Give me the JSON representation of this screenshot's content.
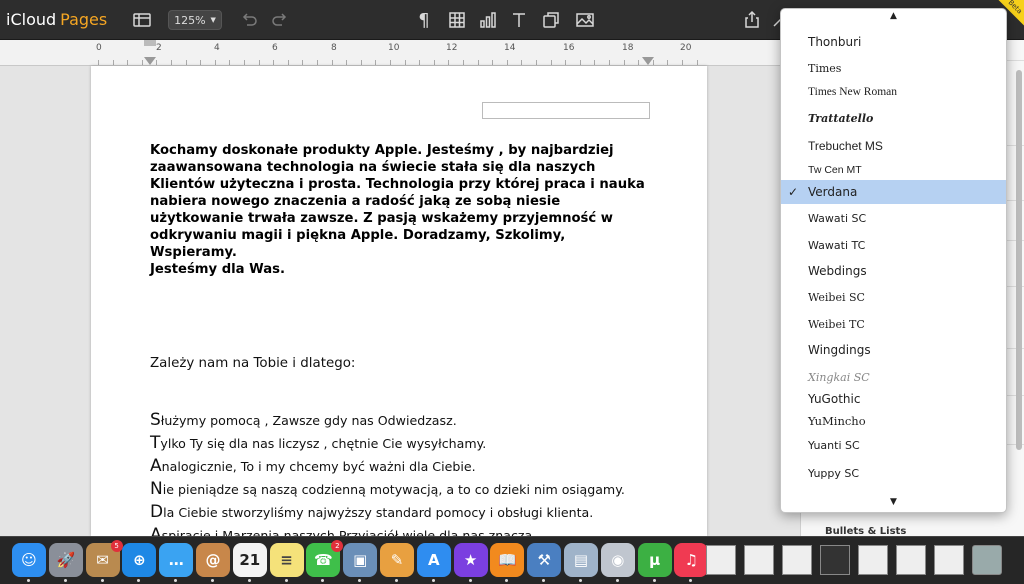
{
  "toolbar": {
    "brand": "iCloud",
    "app_name": "Pages",
    "zoom": "125%",
    "beta_label": "Beta",
    "icons": [
      "sidebar-view-icon",
      "undo-icon",
      "redo-icon",
      "paragraph-icon",
      "table-icon",
      "chart-icon",
      "text-icon",
      "shape-icon",
      "image-icon",
      "share-icon",
      "format-brush-icon"
    ]
  },
  "ruler": {
    "numbers": [
      "0",
      "2",
      "4",
      "6",
      "8",
      "10",
      "12",
      "14",
      "16",
      "18",
      "20"
    ]
  },
  "document": {
    "paragraph": "Kochamy doskonałe produkty Apple. Jesteśmy , by najbardziej zaawansowana technologia na świecie stała się dla naszych Klientów użyteczna i prosta. Technologia przy której praca i nauka nabiera nowego znaczenia a radość jaką ze sobą niesie użytkowanie trwała zawsze. Z pasją wskażemy przyjemność w odkrywaniu magii i piękna Apple. Doradzamy, Szkolimy, Wspieramy.",
    "tagline": "Jesteśmy dla Was.",
    "intro": "Zależy nam na Tobie i dlatego:",
    "list": [
      {
        "cap": "S",
        "rest": "łużymy pomocą , Zawsze gdy nas Odwiedzasz."
      },
      {
        "cap": "T",
        "rest": "ylko Ty się dla nas liczysz , chętnie Cie wysyłchamy."
      },
      {
        "cap": "A",
        "rest": "nalogicznie, To i my chcemy być ważni dla Ciebie."
      },
      {
        "cap": "N",
        "rest": "ie pieniądze są naszą codzienną motywacją, a to co dzieki nim osiągamy."
      },
      {
        "cap": "D",
        "rest": "la Ciebie stworzyliśmy najwyższy standard pomocy i obsługi klienta."
      },
      {
        "cap": "A",
        "rest": "spiracje i Marzenia naszych Przyjaciół wiele dla nas znacza"
      }
    ]
  },
  "inspector": {
    "bullets_title": "Bullets & Lists"
  },
  "font_menu": {
    "selected": "Verdana",
    "items": [
      {
        "label": "Thonburi",
        "font": "DejaVu Sans"
      },
      {
        "label": "Times",
        "font": "DejaVu Serif"
      },
      {
        "label": "Times New Roman",
        "font": "Liberation Serif"
      },
      {
        "label": "Trattatello",
        "font": "DejaVu Serif"
      },
      {
        "label": "Trebuchet MS",
        "font": "Liberation Sans"
      },
      {
        "label": "Tw Cen MT",
        "font": "Liberation Sans"
      },
      {
        "label": "Verdana",
        "font": "DejaVu Sans"
      },
      {
        "label": "Wawati SC",
        "font": "DejaVu Sans"
      },
      {
        "label": "Wawati TC",
        "font": "DejaVu Sans"
      },
      {
        "label": "Webdings",
        "font": "DejaVu Sans"
      },
      {
        "label": "Weibei SC",
        "font": "DejaVu Serif"
      },
      {
        "label": "Weibei TC",
        "font": "DejaVu Serif"
      },
      {
        "label": "Wingdings",
        "font": "DejaVu Sans"
      },
      {
        "label": "Xingkai SC",
        "font": "DejaVu Serif"
      },
      {
        "label": "YuGothic",
        "font": "DejaVu Sans"
      },
      {
        "label": "YuMincho",
        "font": "DejaVu Serif"
      },
      {
        "label": "Yuanti SC",
        "font": "DejaVu Sans"
      },
      {
        "label": "Yuppy SC",
        "font": "DejaVu Sans"
      }
    ]
  },
  "dock": {
    "apps": [
      {
        "name": "finder",
        "color": "#2d8ef0",
        "glyph": "☺"
      },
      {
        "name": "launchpad",
        "color": "#8a8f99",
        "glyph": "🚀"
      },
      {
        "name": "mail-stamp",
        "color": "#b98a4f",
        "glyph": "✉",
        "badge": "5"
      },
      {
        "name": "safari",
        "color": "#1e88e5",
        "glyph": "⊕"
      },
      {
        "name": "messages",
        "color": "#3aa3f2",
        "glyph": "…"
      },
      {
        "name": "contacts",
        "color": "#c8874a",
        "glyph": "@"
      },
      {
        "name": "calendar",
        "color": "#f4f4f4",
        "glyph": "21",
        "text_color": "#222"
      },
      {
        "name": "notes",
        "color": "#f5e27a",
        "glyph": "≡",
        "text_color": "#444"
      },
      {
        "name": "facetime",
        "color": "#3fbf4a",
        "glyph": "☎",
        "badge": "2"
      },
      {
        "name": "photo-browser",
        "color": "#6a8fb8",
        "glyph": "▣"
      },
      {
        "name": "preview",
        "color": "#e8a040",
        "glyph": "✎"
      },
      {
        "name": "app-store",
        "color": "#2f8df0",
        "glyph": "A"
      },
      {
        "name": "imovie-star",
        "color": "#7b3fe0",
        "glyph": "★"
      },
      {
        "name": "ibooks",
        "color": "#f28a1e",
        "glyph": "📖"
      },
      {
        "name": "xcode",
        "color": "#4a7fc1",
        "glyph": "⚒"
      },
      {
        "name": "preview-2",
        "color": "#9fb3c9",
        "glyph": "▤"
      },
      {
        "name": "finder-2",
        "color": "#c0c6cf",
        "glyph": "◉"
      },
      {
        "name": "utorrent",
        "color": "#3cb043",
        "glyph": "μ"
      },
      {
        "name": "itunes",
        "color": "#f03a52",
        "glyph": "♫"
      }
    ]
  }
}
